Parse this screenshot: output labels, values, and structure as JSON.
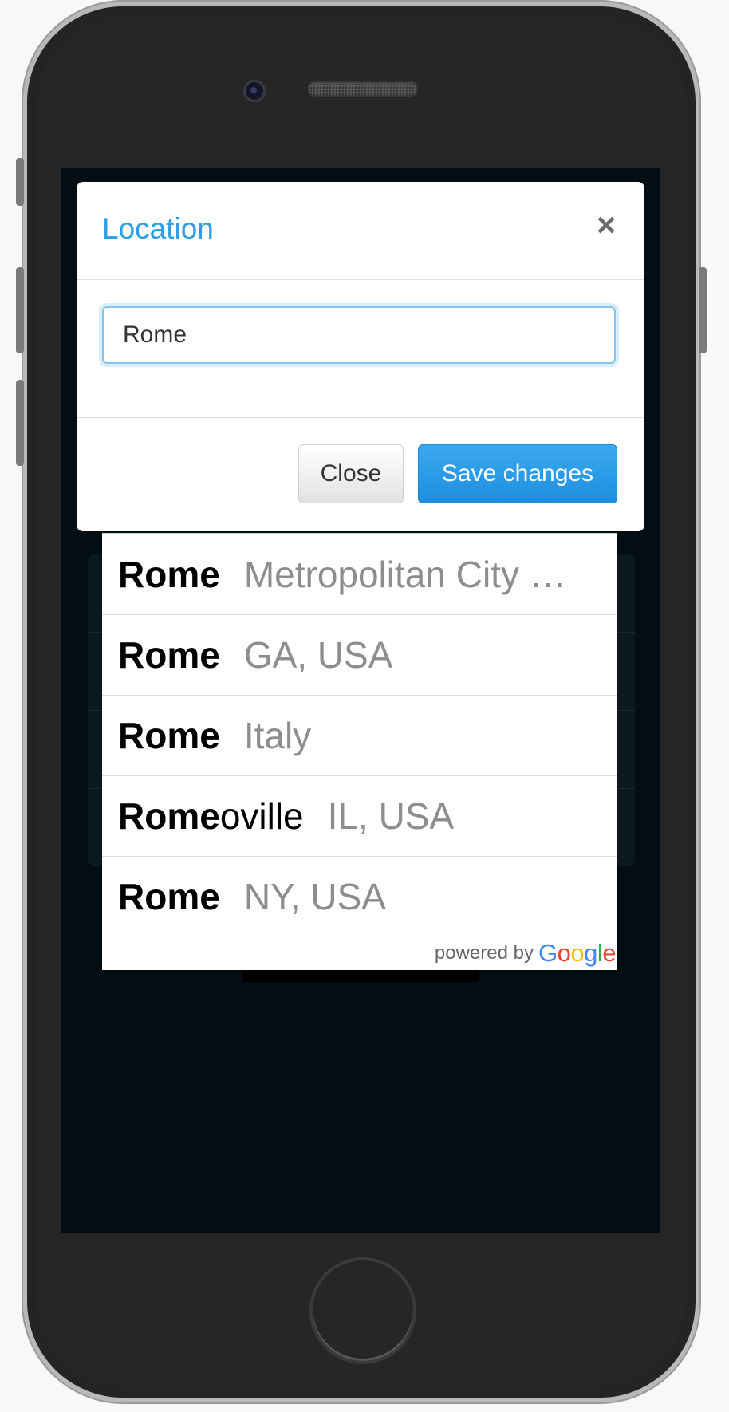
{
  "modal": {
    "title": "Location",
    "close_icon": "×",
    "input": {
      "value": "Rome",
      "placeholder": ""
    },
    "buttons": {
      "close": "Close",
      "save": "Save changes"
    }
  },
  "autocomplete": {
    "items": [
      {
        "match": "Rome",
        "rest": "",
        "secondary": "Metropolitan City of Rome, Italy"
      },
      {
        "match": "Rome",
        "rest": "",
        "secondary": "GA, USA"
      },
      {
        "match": "Rome",
        "rest": "",
        "secondary": "Italy"
      },
      {
        "match": "Rome",
        "rest": "oville",
        "secondary": "IL, USA"
      },
      {
        "match": "Rome",
        "rest": "",
        "secondary": "NY, USA"
      }
    ],
    "powered_by": "powered by",
    "logo_letters": [
      "G",
      "o",
      "o",
      "g",
      "l",
      "e"
    ]
  },
  "colors": {
    "accent": "#2f9fe5",
    "screen_bg": "#020e14",
    "secondary_text": "#8d8d8d"
  }
}
